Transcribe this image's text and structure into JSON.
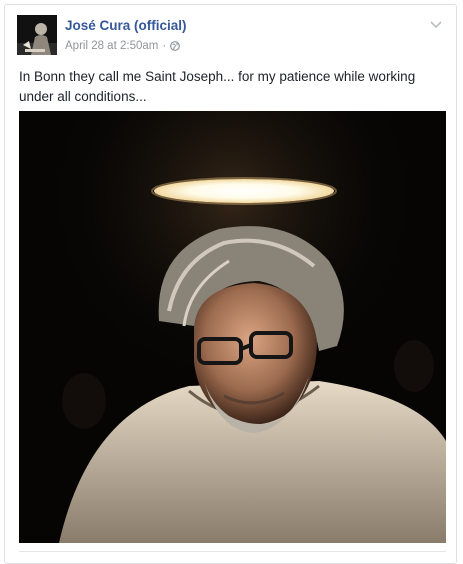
{
  "post": {
    "page_name": "José Cura (official)",
    "timestamp": "April 28 at 2:50am",
    "separator": "·",
    "privacy_icon": "globe-icon",
    "options_icon": "chevron-down-icon",
    "text": "In Bonn they call me Saint Joseph... for my patience while working under all conditions...",
    "avatar_icon": "profile-avatar",
    "photo_subject": "post-photo"
  },
  "colors": {
    "link": "#365899",
    "meta": "#90949c",
    "text": "#1d2129",
    "border": "#dddfe2"
  }
}
